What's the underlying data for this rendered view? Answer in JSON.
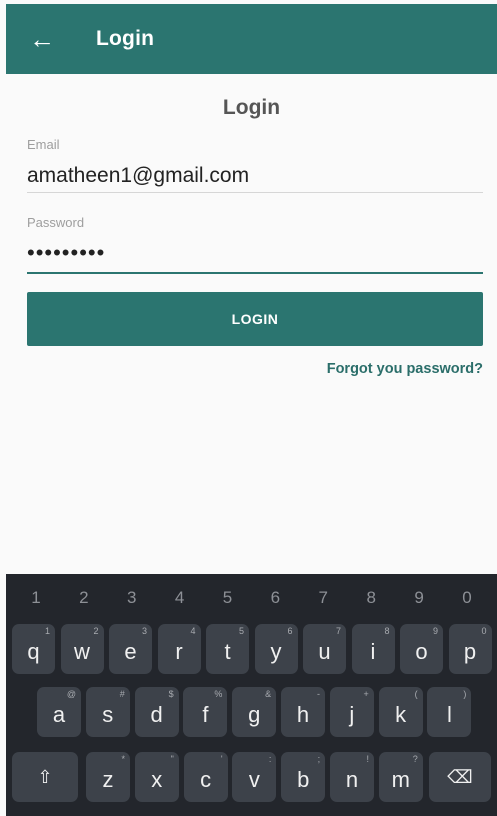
{
  "appbar": {
    "back_icon": "←",
    "title": "Login"
  },
  "form": {
    "title": "Login",
    "email": {
      "label": "Email",
      "value": "amatheen1@gmail.com"
    },
    "password": {
      "label": "Password",
      "value": "•••••••••"
    },
    "login_button": "LOGIN",
    "forgot_link": "Forgot you password?"
  },
  "keyboard": {
    "numbers": [
      "1",
      "2",
      "3",
      "4",
      "5",
      "6",
      "7",
      "8",
      "9",
      "0"
    ],
    "row1": [
      {
        "k": "q",
        "h": "1"
      },
      {
        "k": "w",
        "h": "2"
      },
      {
        "k": "e",
        "h": "3"
      },
      {
        "k": "r",
        "h": "4"
      },
      {
        "k": "t",
        "h": "5"
      },
      {
        "k": "y",
        "h": "6"
      },
      {
        "k": "u",
        "h": "7"
      },
      {
        "k": "i",
        "h": "8"
      },
      {
        "k": "o",
        "h": "9"
      },
      {
        "k": "p",
        "h": "0"
      }
    ],
    "row2": [
      {
        "k": "a",
        "h": "@"
      },
      {
        "k": "s",
        "h": "#"
      },
      {
        "k": "d",
        "h": "$"
      },
      {
        "k": "f",
        "h": "%"
      },
      {
        "k": "g",
        "h": "&"
      },
      {
        "k": "h",
        "h": "-"
      },
      {
        "k": "j",
        "h": "+"
      },
      {
        "k": "k",
        "h": "("
      },
      {
        "k": "l",
        "h": ")"
      }
    ],
    "row3": [
      {
        "k": "z",
        "h": "*"
      },
      {
        "k": "x",
        "h": "\""
      },
      {
        "k": "c",
        "h": "'"
      },
      {
        "k": "v",
        "h": ":"
      },
      {
        "k": "b",
        "h": ";"
      },
      {
        "k": "n",
        "h": "!"
      },
      {
        "k": "m",
        "h": "?"
      }
    ],
    "shift_icon": "⇧",
    "backspace_icon": "⌫"
  }
}
